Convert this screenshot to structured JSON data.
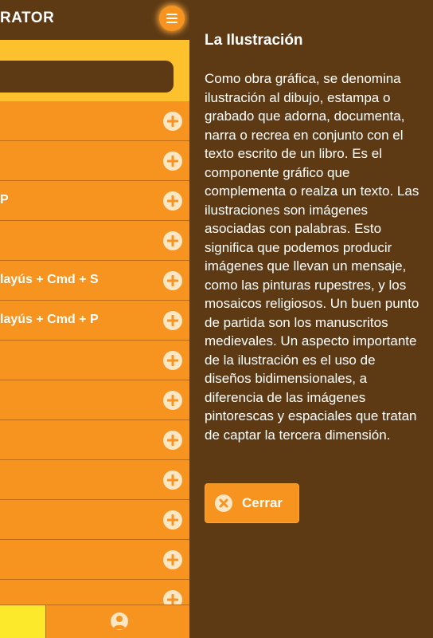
{
  "app": {
    "brand": "RATOR"
  },
  "menu": {
    "rows": [
      {
        "label": ""
      },
      {
        "label": ""
      },
      {
        "label": "P"
      },
      {
        "label": ""
      },
      {
        "label": "layús + Cmd + S"
      },
      {
        "label": "layús + Cmd + P"
      },
      {
        "label": ""
      },
      {
        "label": ""
      },
      {
        "label": ""
      },
      {
        "label": ""
      },
      {
        "label": ""
      },
      {
        "label": ""
      },
      {
        "label": ""
      }
    ]
  },
  "drawer": {
    "title": "La Ilustración",
    "body": "Como obra gráfica, se denomina ilustración al dibujo, estampa o grabado que adorna, documenta, narra o recrea en conjunto con el texto escrito de un libro. Es el componente gráfico que complementa o realza un texto. Las ilustraciones son imágenes asociadas con palabras. Esto significa que podemos producir imágenes que llevan un mensaje, como las pinturas rupestres, y los mosaicos religiosos. Un buen punto de partida son los manuscritos medievales. Un aspecto importante de la ilustración es el uso de diseños bidimensionales, a diferencia de las imágenes pintorescas y espaciales que tratan de captar la tercera dimensión.",
    "close_label": "Cerrar"
  },
  "icons": {
    "menu": "hamburger-menu-icon",
    "add": "plus-circle-icon",
    "close": "close-x-icon",
    "user": "user-icon"
  },
  "colors": {
    "brown": "#5e3a14",
    "orange": "#f7931f",
    "yellow": "#fcc12d",
    "footer_yellow": "#fde92b"
  }
}
